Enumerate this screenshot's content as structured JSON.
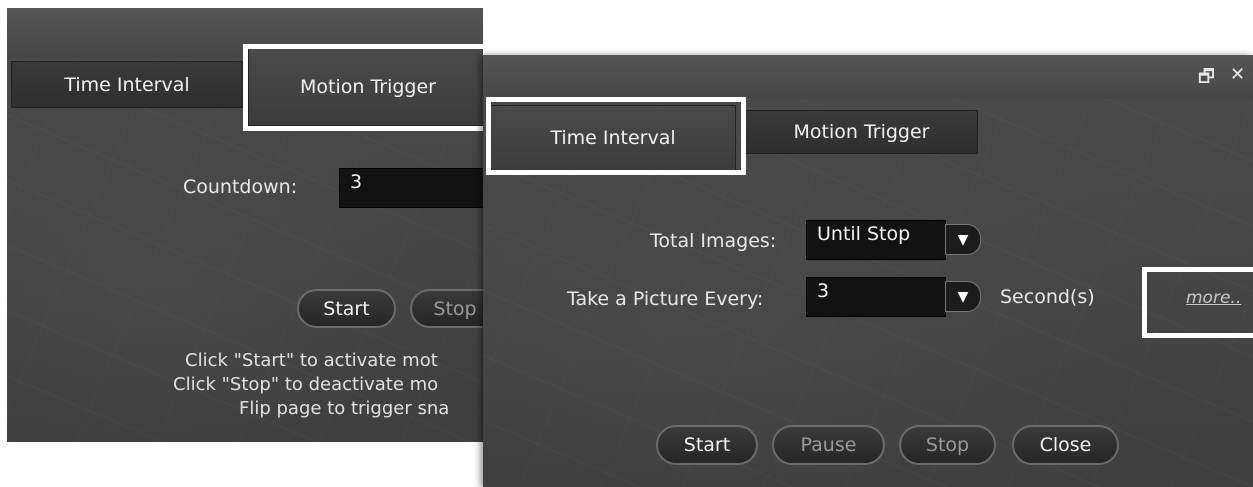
{
  "back_dialog": {
    "tabs": [
      {
        "label": "Time Interval"
      },
      {
        "label": "Motion Trigger"
      }
    ],
    "countdown_label": "Countdown:",
    "countdown_value": "3",
    "start_label": "Start",
    "stop_label": "Stop",
    "instructions": [
      "Click \"Start\" to activate mot",
      "Click \"Stop\" to deactivate mo",
      "Flip page to trigger sna"
    ]
  },
  "front_dialog": {
    "window_controls": {
      "restore_glyph": "🗗",
      "close_glyph": "✕"
    },
    "tabs": [
      {
        "label": "Time Interval"
      },
      {
        "label": "Motion Trigger"
      }
    ],
    "total_images_label": "Total Images:",
    "total_images_value": "Until Stop",
    "interval_label": "Take a Picture Every:",
    "interval_value": "3",
    "interval_unit": "Second(s)",
    "more_link": "more..",
    "buttons": {
      "start": "Start",
      "pause": "Pause",
      "stop": "Stop",
      "close": "Close"
    }
  },
  "colors": {
    "panel": "#444444",
    "highlight": "#ffffff",
    "field_bg": "#121212"
  }
}
